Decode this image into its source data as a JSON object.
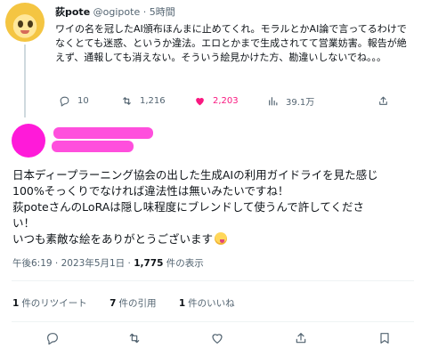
{
  "parent_tweet": {
    "name": "荻pote",
    "handle": "@ogipote",
    "dot": "·",
    "time": "5時間",
    "text": "ワイの名を冠したAI頒布ほんまに止めてくれ。モラルとかAI論で言ってるわけでなくとても迷惑、というか違法。エロとかまで生成されてて営業妨害。報告が絶えず、通報しても消えない。そういう絵見かけた方、勘違いしないでね。。。",
    "actions": {
      "reply_count": "10",
      "retweet_count": "1,216",
      "like_count": "2,203",
      "view_count": "39.1万"
    },
    "icons": {
      "reply": "reply-icon",
      "retweet": "retweet-icon",
      "like": "heart-filled-icon",
      "views": "analytics-icon",
      "share": "share-icon"
    },
    "colors": {
      "like_active": "#f91880",
      "muted": "#536471"
    }
  },
  "main_tweet": {
    "text_lines": [
      "日本ディープラーニング協会の出した生成AIの利用ガイドライを見た感じ",
      "100%そっくりでなければ違法性は無いみたいですね！",
      "荻poteさんのLoRAは隠し味程度にブレンドして使うんで許してくださ",
      "い！",
      "いつも素敵な絵をありがとうございます"
    ],
    "emoji": "savoring-food-emoji",
    "meta": {
      "timestamp": "午後6:19 · 2023年5月1日 · ",
      "views_count": "1,775",
      "views_label": " 件の表示"
    },
    "stats": [
      {
        "count": "1",
        "label": "件のリツイート"
      },
      {
        "count": "7",
        "label": "件の引用"
      },
      {
        "count": "1",
        "label": "件のいいね"
      }
    ],
    "redaction_color": "#ff1ad9",
    "action_icons": [
      "reply-icon",
      "retweet-icon",
      "heart-icon",
      "share-icon",
      "bookmark-icon"
    ]
  }
}
